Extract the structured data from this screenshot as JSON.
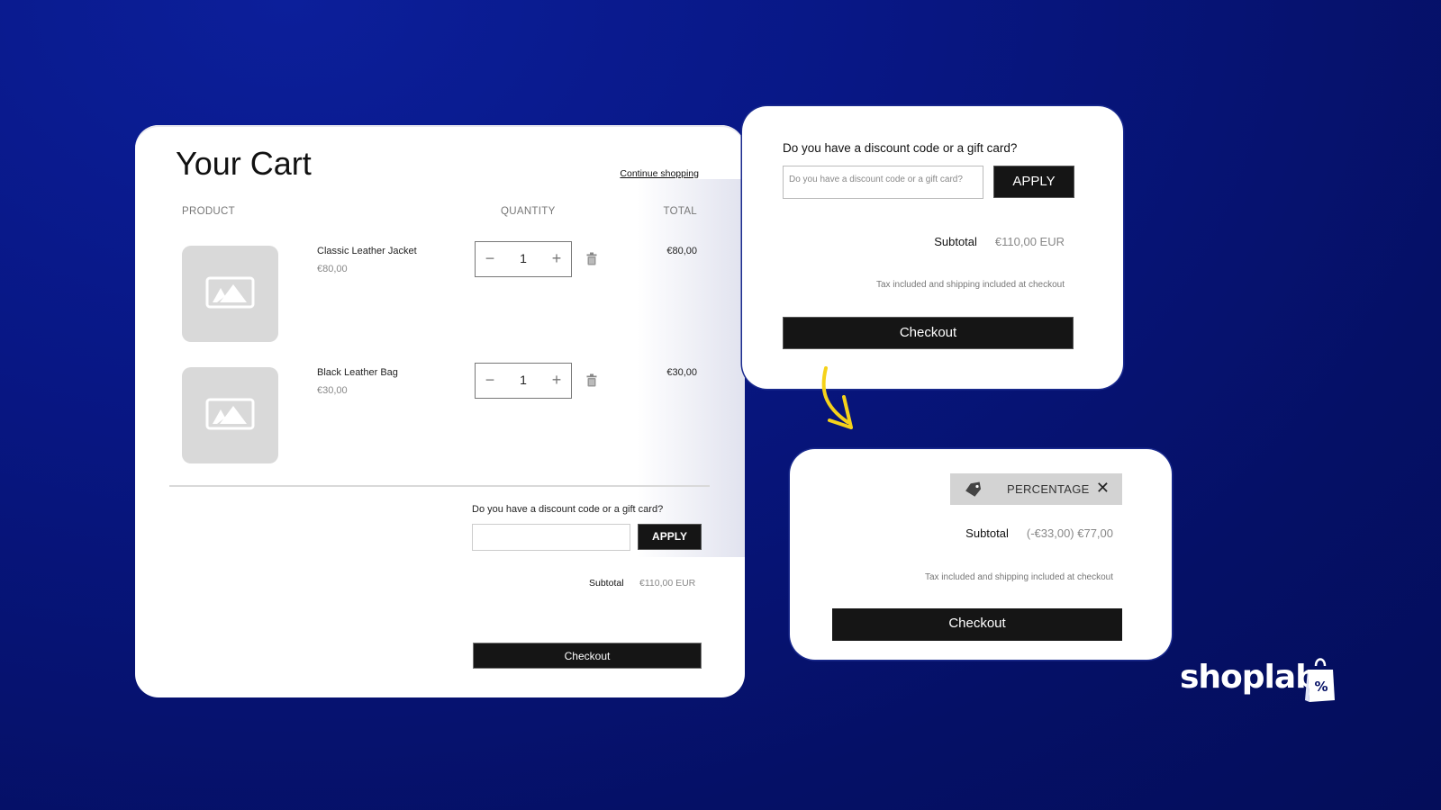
{
  "main_cart": {
    "title": "Your Cart",
    "continue_link": "Continue shopping",
    "columns": {
      "product": "PRODUCT",
      "quantity": "QUANTITY",
      "total": "TOTAL"
    },
    "items": [
      {
        "name": "Classic Leather Jacket",
        "price": "€80,00",
        "quantity": "1",
        "line_total": "€80,00",
        "image_icon": "image-placeholder-icon"
      },
      {
        "name": "Black Leather Bag",
        "price": "€30,00",
        "quantity": "1",
        "line_total": "€30,00",
        "image_icon": "image-placeholder-icon"
      }
    ],
    "qty_minus": "−",
    "qty_plus": "+",
    "discount_label": "Do you have a discount code or a gift card?",
    "discount_value": "",
    "apply_label": "APPLY",
    "subtotal_label": "Subtotal",
    "subtotal_value": "€110,00 EUR",
    "checkout_label": "Checkout"
  },
  "discount_card": {
    "question": "Do you have a discount code or a gift card?",
    "input_placeholder": "Do you have a discount code or a gift card?",
    "apply_label": "APPLY",
    "subtotal_label": "Subtotal",
    "subtotal_value": "€110,00 EUR",
    "tax_note": "Tax included and shipping included at checkout",
    "checkout_label": "Checkout"
  },
  "applied_card": {
    "discount_chip_label": "PERCENTAGE",
    "remove_symbol": "✕",
    "subtotal_label": "Subtotal",
    "subtotal_value": "(-€33,00) €77,00",
    "tax_note": "Tax included and shipping included at checkout",
    "checkout_label": "Checkout"
  },
  "brand": {
    "name": "shoplab",
    "badge_symbol": "%"
  },
  "colors": {
    "background": "#081785",
    "button": "#151515",
    "arrow": "#f5d21a",
    "chip": "#d3d3d3"
  }
}
